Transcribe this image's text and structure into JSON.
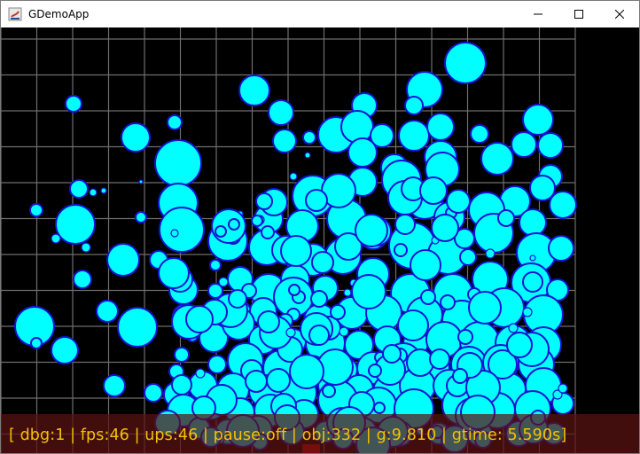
{
  "window": {
    "title": "GDemoApp",
    "icons": {
      "app": "java-app-icon",
      "minimize": "minimize-icon",
      "maximize": "maximize-icon",
      "close": "close-icon"
    }
  },
  "colors": {
    "background": "#000000",
    "grid": "#6e6e6e",
    "ball_fill": "#00ffff",
    "ball_stroke": "#1414d2",
    "hud_bg": "rgba(92,18,18,0.72)",
    "hud_text": "#f5c200"
  },
  "hud": {
    "status_line": "[ dbg:1 | fps:46 | ups:46 | pause:off | obj:332 | g:9.810 | gtime: 5.590s]"
  },
  "scene": {
    "grid": true,
    "object_count": 332
  }
}
